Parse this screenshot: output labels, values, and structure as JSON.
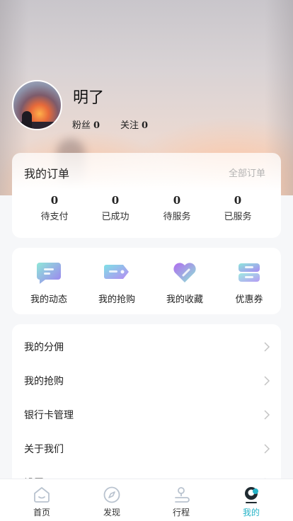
{
  "profile": {
    "name": "明了",
    "fans_label": "粉丝",
    "fans_count": "0",
    "follow_label": "关注",
    "follow_count": "0"
  },
  "orders": {
    "title": "我的订单",
    "all_label": "全部订单",
    "items": [
      {
        "count": "0",
        "label": "待支付"
      },
      {
        "count": "0",
        "label": "已成功"
      },
      {
        "count": "0",
        "label": "待服务"
      },
      {
        "count": "0",
        "label": "已服务"
      }
    ]
  },
  "quick": [
    {
      "label": "我的动态",
      "icon": "chat-bubble-icon"
    },
    {
      "label": "我的抢购",
      "icon": "tag-icon"
    },
    {
      "label": "我的收藏",
      "icon": "heart-icon"
    },
    {
      "label": "优惠券",
      "icon": "coupon-icon"
    }
  ],
  "menu": [
    {
      "label": "我的分佣"
    },
    {
      "label": "我的抢购"
    },
    {
      "label": "银行卡管理"
    },
    {
      "label": "关于我们"
    },
    {
      "label": "设置"
    }
  ],
  "tabbar": [
    {
      "label": "首页",
      "icon": "home-icon"
    },
    {
      "label": "发现",
      "icon": "compass-icon"
    },
    {
      "label": "行程",
      "icon": "route-icon"
    },
    {
      "label": "我的",
      "icon": "profile-icon",
      "active": true
    }
  ],
  "colors": {
    "accent": "#25b3c7",
    "muted": "#b3b3b3",
    "page_bg": "#f6f7f9"
  }
}
